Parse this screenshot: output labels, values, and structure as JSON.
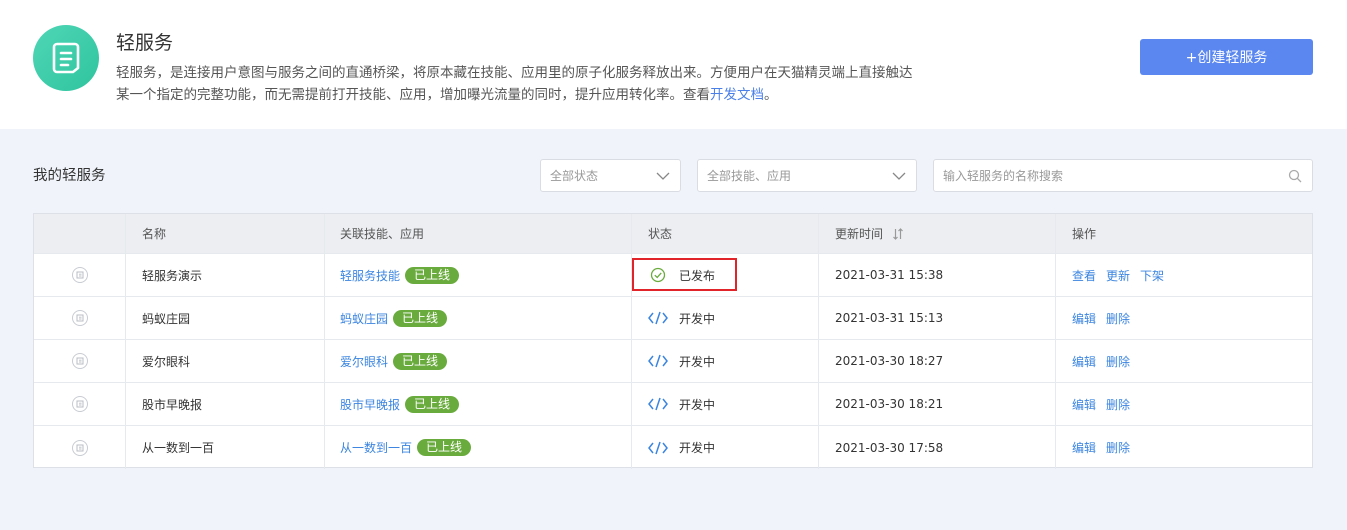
{
  "header": {
    "title": "轻服务",
    "desc_line1": "轻服务，是连接用户意图与服务之间的直通桥梁，将原本藏在技能、应用里的原子化服务释放出来。方便用户在天猫精灵端上直接触达",
    "desc_line2_prefix": "某一个指定的完整功能，而无需提前打开技能、应用，增加曝光流量的同时，提升应用转化率。查看",
    "desc_link": "开发文档",
    "desc_suffix": "。",
    "create_button": "+创建轻服务",
    "logo_icon": "document-list-icon"
  },
  "section": {
    "title": "我的轻服务"
  },
  "filters": {
    "status_select": "全部状态",
    "skill_select": "全部技能、应用",
    "search_placeholder": "输入轻服务的名称搜索"
  },
  "table": {
    "columns": [
      "",
      "名称",
      "关联技能、应用",
      "状态",
      "更新时间",
      "操作"
    ],
    "rows": [
      {
        "name": "轻服务演示",
        "skill": "轻服务技能",
        "badge": "已上线",
        "status": "已发布",
        "status_type": "published",
        "time": "2021-03-31 15:38",
        "ops": [
          "查看",
          "更新",
          "下架"
        ]
      },
      {
        "name": "蚂蚁庄园",
        "skill": "蚂蚁庄园",
        "badge": "已上线",
        "status": "开发中",
        "status_type": "dev",
        "time": "2021-03-31 15:13",
        "ops": [
          "编辑",
          "删除"
        ]
      },
      {
        "name": "爱尔眼科",
        "skill": "爱尔眼科",
        "badge": "已上线",
        "status": "开发中",
        "status_type": "dev",
        "time": "2021-03-30 18:27",
        "ops": [
          "编辑",
          "删除"
        ]
      },
      {
        "name": "股市早晚报",
        "skill": "股市早晚报",
        "badge": "已上线",
        "status": "开发中",
        "status_type": "dev",
        "time": "2021-03-30 18:21",
        "ops": [
          "编辑",
          "删除"
        ]
      },
      {
        "name": "从一数到一百",
        "skill": "从一数到一百",
        "badge": "已上线",
        "status": "开发中",
        "status_type": "dev",
        "time": "2021-03-30 17:58",
        "ops": [
          "编辑",
          "删除"
        ]
      }
    ]
  },
  "colors": {
    "primary": "#5b87f0",
    "link": "#3b85e0",
    "badge": "#6aab3e",
    "published": "#6aab3e",
    "dev": "#3b85e0",
    "highlight": "#e0242a"
  }
}
